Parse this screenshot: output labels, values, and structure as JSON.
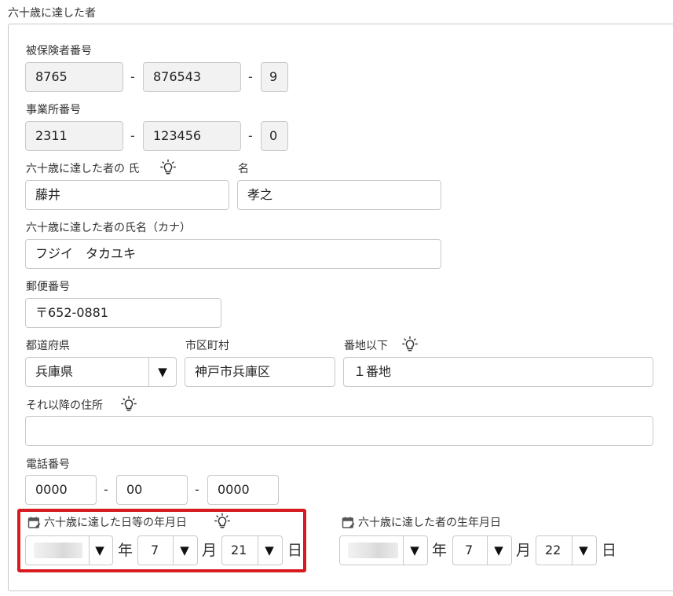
{
  "section": {
    "title": "六十歳に達した者"
  },
  "insured_number": {
    "label": "被保険者番号",
    "part1": "8765",
    "part2": "876543",
    "part3": "9",
    "separator": "-"
  },
  "office_number": {
    "label": "事業所番号",
    "part1": "2311",
    "part2": "123456",
    "part3": "0",
    "separator": "-"
  },
  "name": {
    "last_label": "六十歳に達した者の 氏",
    "last_value": "藤井",
    "first_label": "名",
    "first_value": "孝之"
  },
  "name_kana": {
    "label": "六十歳に達した者の氏名（カナ）",
    "value": "フジイ　タカユキ"
  },
  "postal": {
    "label": "郵便番号",
    "value": "〒652-0881"
  },
  "address": {
    "prefecture_label": "都道府県",
    "prefecture_value": "兵庫県",
    "city_label": "市区町村",
    "city_value": "神戸市兵庫区",
    "street_label": "番地以下",
    "street_value": "１番地",
    "extra_label": "それ以降の住所",
    "extra_value": ""
  },
  "phone": {
    "label": "電話番号",
    "part1": "0000",
    "part2": "00",
    "part3": "0000",
    "separator": "-"
  },
  "reach_date": {
    "label": "六十歳に達した日等の年月日",
    "year_value": "",
    "year_unit": "年",
    "month_value": "7",
    "month_unit": "月",
    "day_value": "21",
    "day_unit": "日"
  },
  "birth_date": {
    "label": "六十歳に達した者の生年月日",
    "year_value": "",
    "year_unit": "年",
    "month_value": "7",
    "month_unit": "月",
    "day_value": "22",
    "day_unit": "日"
  },
  "icons": {
    "hint": "lightbulb-icon",
    "calendar": "calendar-edit-icon",
    "dropdown": "dropdown-triangle-icon"
  },
  "colors": {
    "highlight": "#d71920",
    "readonly_bg": "#f2f2f2",
    "border": "#c9c9c9"
  }
}
